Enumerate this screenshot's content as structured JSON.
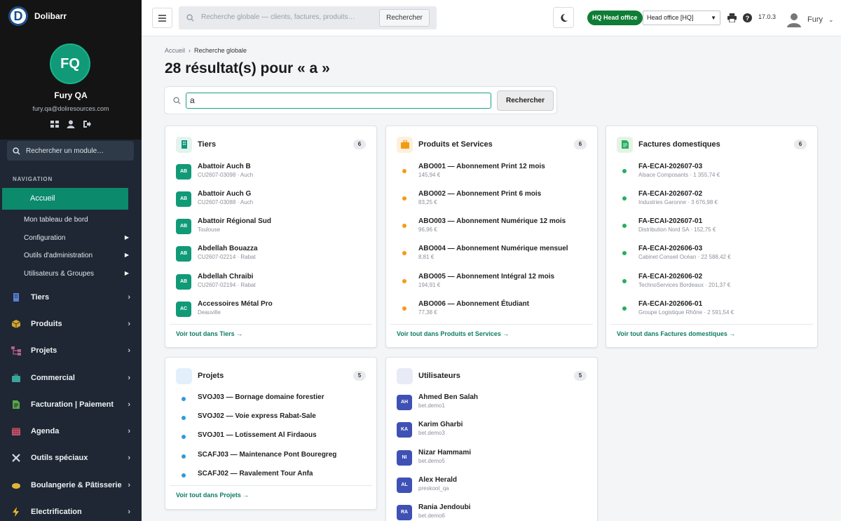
{
  "app": {
    "brand": "Dolibarr",
    "logo_letter": "D"
  },
  "user": {
    "initials": "FQ",
    "name": "Fury QA",
    "email": "fury.qa@doliresources.com",
    "top_name": "Fury"
  },
  "sidebar": {
    "search_placeholder": "Rechercher un module…",
    "nav_label": "NAVIGATION",
    "active": "Accueil",
    "sub_items": [
      {
        "label": "Mon tableau de bord"
      },
      {
        "label": "Configuration"
      },
      {
        "label": "Outils d'administration"
      },
      {
        "label": "Utilisateurs & Groupes"
      }
    ],
    "main_items": [
      {
        "label": "Tiers"
      },
      {
        "label": "Produits"
      },
      {
        "label": "Projets"
      },
      {
        "label": "Commercial"
      },
      {
        "label": "Facturation | Paiement"
      },
      {
        "label": "Agenda"
      },
      {
        "label": "Outils spéciaux"
      },
      {
        "label": "Boulangerie & Pâtisserie"
      },
      {
        "label": "Electrification"
      }
    ]
  },
  "topbar": {
    "search_placeholder": "Recherche globale — clients, factures, produits…",
    "search_button": "Rechercher",
    "entity_badge": "HQ Head office",
    "entity_select": "Head office [HQ]",
    "version": "17.0.3"
  },
  "breadcrumb": {
    "home": "Accueil",
    "current": "Recherche globale"
  },
  "page": {
    "title": "28 résultat(s) pour « a »",
    "query": "a",
    "search_button": "Rechercher"
  },
  "colors": {
    "accent": "#0c8a6c",
    "sidebar": "#1e2733",
    "orange": "#f39c12",
    "green": "#27ae60",
    "blue": "#3498db",
    "indigo": "#3f51b5"
  },
  "cards": {
    "tiers": {
      "title": "Tiers",
      "count": "6",
      "link": "Voir tout dans Tiers →",
      "rows": [
        {
          "av": "AB",
          "t1": "Abattoir Auch B",
          "t2": "CU2607-03098 · Auch"
        },
        {
          "av": "AB",
          "t1": "Abattoir Auch G",
          "t2": "CU2607-03088 · Auch"
        },
        {
          "av": "AB",
          "t1": "Abattoir Régional Sud",
          "t2": "Toulouse"
        },
        {
          "av": "AB",
          "t1": "Abdellah Bouazza",
          "t2": "CU2607-02214 · Rabat"
        },
        {
          "av": "AB",
          "t1": "Abdellah Chraibi",
          "t2": "CU2607-02194 · Rabat"
        },
        {
          "av": "AC",
          "t1": "Accessoires Métal Pro",
          "t2": "Deauville"
        }
      ]
    },
    "produits": {
      "title": "Produits et Services",
      "count": "6",
      "link": "Voir tout dans Produits et Services →",
      "rows": [
        {
          "t1": "ABO001 — Abonnement Print 12 mois",
          "t2": "145,94 €"
        },
        {
          "t1": "ABO002 — Abonnement Print 6 mois",
          "t2": "83,25 €"
        },
        {
          "t1": "ABO003 — Abonnement Numérique 12 mois",
          "t2": "96,96 €"
        },
        {
          "t1": "ABO004 — Abonnement Numérique mensuel",
          "t2": "8,81 €"
        },
        {
          "t1": "ABO005 — Abonnement Intégral 12 mois",
          "t2": "194,91 €"
        },
        {
          "t1": "ABO006 — Abonnement Étudiant",
          "t2": "77,38 €"
        }
      ]
    },
    "factures": {
      "title": "Factures domestiques",
      "count": "6",
      "link": "Voir tout dans Factures domestiques →",
      "rows": [
        {
          "t1": "FA-ECAI-202607-03",
          "t2": "Alsace Composants · 1 355,74 €"
        },
        {
          "t1": "FA-ECAI-202607-02",
          "t2": "Industries Garonne · 3 676,98 €"
        },
        {
          "t1": "FA-ECAI-202607-01",
          "t2": "Distribution Nord SA · 152,75 €"
        },
        {
          "t1": "FA-ECAI-202606-03",
          "t2": "Cabinet Conseil Océan · 22 588,42 €"
        },
        {
          "t1": "FA-ECAI-202606-02",
          "t2": "TechnoServices Bordeaux · 201,37 €"
        },
        {
          "t1": "FA-ECAI-202606-01",
          "t2": "Groupe Logistique Rhône · 2 591,54 €"
        }
      ]
    },
    "projets": {
      "title": "Projets",
      "count": "5",
      "link": "Voir tout dans Projets →",
      "rows": [
        {
          "t1": "SVOJ03 — Bornage domaine forestier"
        },
        {
          "t1": "SVOJ02 — Voie express Rabat-Sale"
        },
        {
          "t1": "SVOJ01 — Lotissement Al Firdaous"
        },
        {
          "t1": "SCAFJ03 — Maintenance Pont Bouregreg"
        },
        {
          "t1": "SCAFJ02 — Ravalement Tour Anfa"
        }
      ]
    },
    "utilisateurs": {
      "title": "Utilisateurs",
      "count": "5",
      "rows": [
        {
          "av": "AH",
          "t1": "Ahmed Ben Salah",
          "t2": "bet.demo1"
        },
        {
          "av": "KA",
          "t1": "Karim Gharbi",
          "t2": "bet.demo3"
        },
        {
          "av": "NI",
          "t1": "Nizar Hammami",
          "t2": "bet.demo5"
        },
        {
          "av": "AL",
          "t1": "Alex Herald",
          "t2": "preskool_qa"
        },
        {
          "av": "RA",
          "t1": "Rania Jendoubi",
          "t2": "bet.demo6"
        }
      ]
    }
  }
}
